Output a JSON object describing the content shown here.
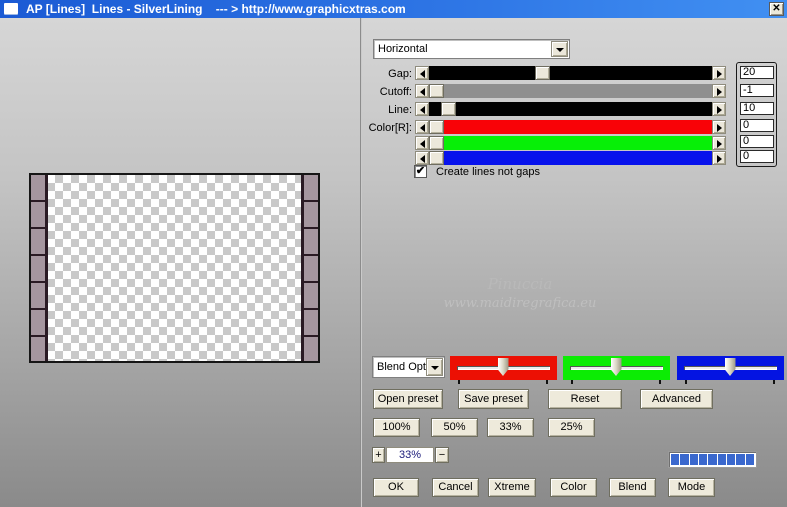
{
  "window": {
    "title": "AP [Lines]  Lines - SilverLining    --- > http://www.graphicxtras.com"
  },
  "icons": {
    "close": "✕",
    "check": "✔"
  },
  "controls": {
    "mode_select": {
      "value": "Horizontal"
    },
    "sliders": [
      {
        "label": "Gap:",
        "value": "20",
        "track_color": "#000000"
      },
      {
        "label": "Cutoff:",
        "value": "-1",
        "track_color": "#8f8f8f"
      },
      {
        "label": "Line:",
        "value": "10",
        "track_color": "#000000"
      },
      {
        "label": "Color[R]:",
        "value": "0",
        "track_color": "#f90207"
      },
      {
        "label": "",
        "value": "0",
        "track_color": "#07ef07"
      },
      {
        "label": "",
        "value": "0",
        "track_color": "#0712ec"
      }
    ],
    "lines_checkbox": {
      "checked": true,
      "label": "Create lines not gaps"
    },
    "blend_select": {
      "value": "Blend Opti"
    },
    "channel_sliders": [
      {
        "name": "red",
        "color": "#ec1004"
      },
      {
        "name": "green",
        "color": "#0cec04"
      },
      {
        "name": "blue",
        "color": "#0414e2"
      }
    ],
    "preset_buttons": {
      "open": "Open preset",
      "save": "Save preset",
      "reset": "Reset",
      "advanced": "Advanced"
    },
    "zoom_buttons": {
      "b100": "100%",
      "b50": "50%",
      "b33": "33%",
      "b25": "25%"
    },
    "zoom_stepper": {
      "plus": "+",
      "value": "33%",
      "minus": "−"
    },
    "progress": {
      "segments": 9
    },
    "action_buttons": {
      "ok": "OK",
      "cancel": "Cancel",
      "xtreme": "Xtreme",
      "color": "Color",
      "blend": "Blend",
      "mode": "Mode"
    }
  },
  "watermark": {
    "line1": "Pinuccia",
    "line2": "www.maidiregrafica.eu"
  }
}
